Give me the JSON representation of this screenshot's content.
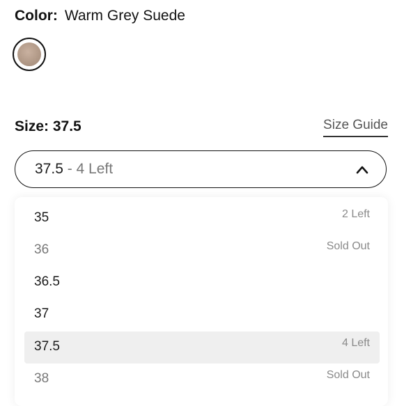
{
  "color": {
    "label": "Color:",
    "value": "Warm Grey Suede",
    "swatch_color": "#b8a090"
  },
  "size": {
    "label": "Size:",
    "value": "37.5",
    "guide_label": "Size Guide"
  },
  "select": {
    "size": "37.5",
    "separator": " - ",
    "stock": "4 Left"
  },
  "options": [
    {
      "size": "35",
      "stock": "2 Left"
    },
    {
      "size": "36",
      "stock": "Sold Out"
    },
    {
      "size": "36.5",
      "stock": ""
    },
    {
      "size": "37",
      "stock": ""
    },
    {
      "size": "37.5",
      "stock": "4 Left"
    },
    {
      "size": "38",
      "stock": "Sold Out"
    }
  ],
  "selected_option": "37.5"
}
